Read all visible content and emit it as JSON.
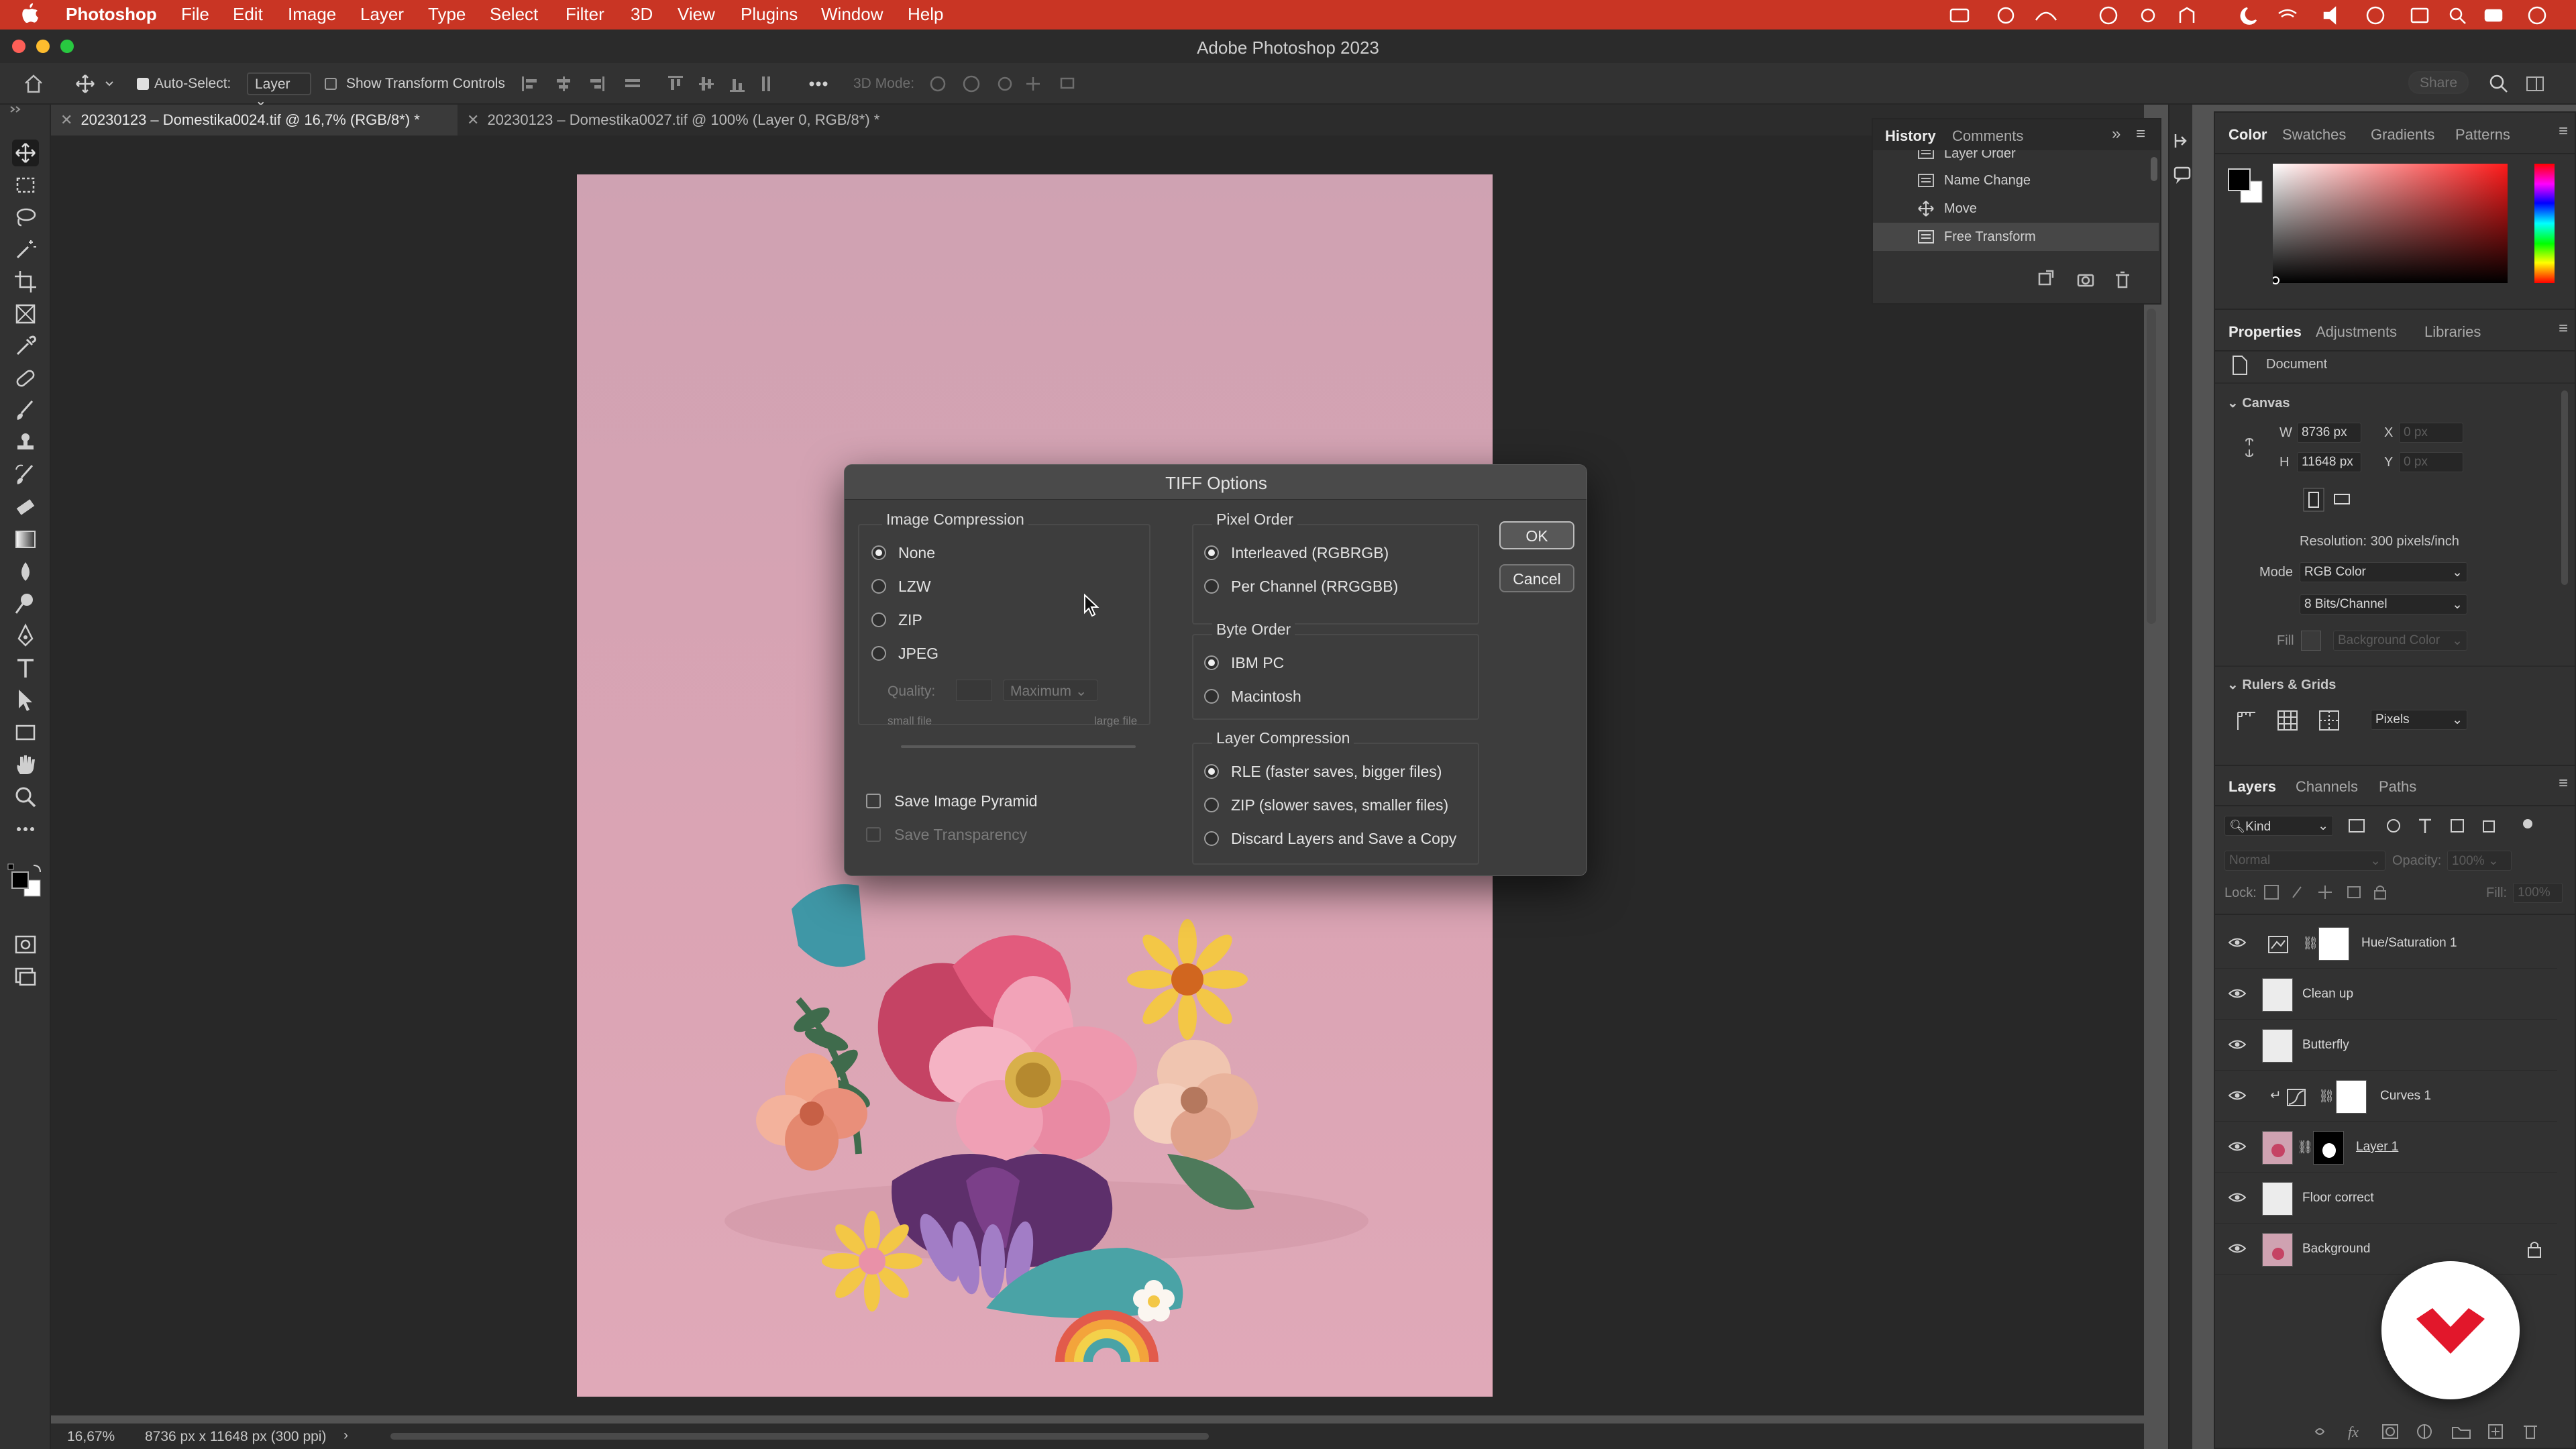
{
  "menubar": {
    "app": "Photoshop",
    "items": [
      "File",
      "Edit",
      "Image",
      "Layer",
      "Type",
      "Select",
      "Filter",
      "3D",
      "View",
      "Plugins",
      "Window",
      "Help"
    ],
    "bg": "#c93524"
  },
  "window": {
    "title": "Adobe Photoshop 2023"
  },
  "options": {
    "auto_select_label": "Auto-Select:",
    "auto_select_value": "Layer",
    "transform_label": "Show Transform Controls",
    "mode3d_label": "3D Mode:",
    "share_label": "Share"
  },
  "tabs": [
    {
      "label": "20230123 – Domestika0024.tif @ 16,7% (RGB/8*) *",
      "active": true
    },
    {
      "label": "20230123 – Domestika0027.tif @ 100% (Layer 0, RGB/8*) *",
      "active": false
    }
  ],
  "status": {
    "zoom": "16,67%",
    "doc_size": "8736 px x 11648 px (300 ppi)"
  },
  "history": {
    "tabs": [
      "History",
      "Comments"
    ],
    "items": [
      "Layer Order",
      "Name Change",
      "Move",
      "Free Transform"
    ],
    "current": "Free Transform"
  },
  "color_panel": {
    "tabs": [
      "Color",
      "Swatches",
      "Gradients",
      "Patterns"
    ]
  },
  "properties": {
    "tabs": [
      "Properties",
      "Adjustments",
      "Libraries"
    ],
    "doc_label": "Document",
    "canvas_label": "Canvas",
    "w_label": "W",
    "w_value": "8736 px",
    "h_label": "H",
    "h_value": "11648 px",
    "x_label": "X",
    "x_value": "0 px",
    "y_label": "Y",
    "y_value": "0 px",
    "resolution": "Resolution: 300 pixels/inch",
    "mode_label": "Mode",
    "mode_value": "RGB Color",
    "bits_value": "8 Bits/Channel",
    "fill_label": "Fill",
    "fill_value": "Background Color",
    "rulers_label": "Rulers & Grids",
    "units_value": "Pixels"
  },
  "layers": {
    "tabs": [
      "Layers",
      "Channels",
      "Paths"
    ],
    "kind_label": "Kind",
    "blend_mode": "Normal",
    "opacity_label": "Opacity:",
    "opacity_value": "100%",
    "lock_label": "Lock:",
    "fill_label": "Fill:",
    "fill_value": "100%",
    "items": [
      {
        "name": "Hue/Saturation 1"
      },
      {
        "name": "Clean up"
      },
      {
        "name": "Butterfly"
      },
      {
        "name": "Curves 1"
      },
      {
        "name": "Layer 1"
      },
      {
        "name": "Floor correct"
      },
      {
        "name": "Background"
      }
    ]
  },
  "dialog": {
    "title": "TIFF Options",
    "image_compression": {
      "title": "Image Compression",
      "options": [
        "None",
        "LZW",
        "ZIP",
        "JPEG"
      ],
      "selected": "None",
      "quality_label": "Quality:",
      "quality_value": "Maximum",
      "small_file": "small file",
      "large_file": "large file"
    },
    "pixel_order": {
      "title": "Pixel Order",
      "options": [
        "Interleaved (RGBRGB)",
        "Per Channel (RRGGBB)"
      ],
      "selected": "Interleaved (RGBRGB)"
    },
    "byte_order": {
      "title": "Byte Order",
      "options": [
        "IBM PC",
        "Macintosh"
      ],
      "selected": "IBM PC"
    },
    "layer_compression": {
      "title": "Layer Compression",
      "options": [
        "RLE (faster saves, bigger files)",
        "ZIP (slower saves, smaller files)",
        "Discard Layers and Save a Copy"
      ],
      "selected": "RLE (faster saves, bigger files)"
    },
    "save_pyramid": "Save Image Pyramid",
    "save_transparency": "Save Transparency",
    "ok": "OK",
    "cancel": "Cancel"
  }
}
